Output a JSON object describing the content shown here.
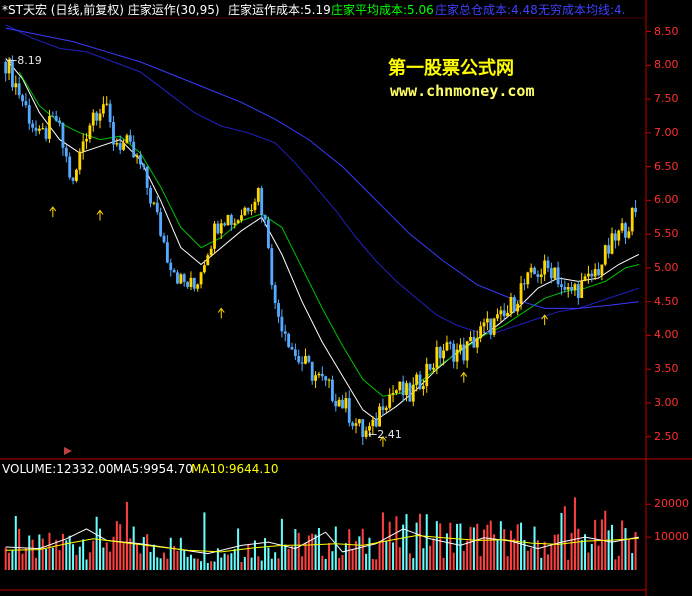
{
  "header": {
    "stock_name": "*ST天宏",
    "period_label": "(日线,前复权)",
    "indicator_name": "庄家运作",
    "indicator_params": "(30,95)",
    "cost_label": "庄家运作成本:5.19",
    "avg_cost_label": "庄家平均成本:5.06",
    "chip_cost_label": "庄家总仓成本:4.48",
    "infinite_cost_label": "无穷成本均线:4."
  },
  "watermark": {
    "title": "第一股票公式网",
    "url": "www.chnmoney.com"
  },
  "volume_header": {
    "volume_label": "VOLUME:12332.00",
    "ma5_label": "MA5:9954.70",
    "ma10_label": "MA10:9644.10"
  },
  "annotations": {
    "high_label": "8.19",
    "low_label": "2.41"
  },
  "colors": {
    "up": "#ffd700",
    "down": "#55aaff",
    "axis": "#c00000",
    "price_tick_text": "#ff3030",
    "header_white": "#ffffff",
    "header_green": "#00ff00",
    "header_blue": "#4040ff",
    "watermark_title": "#ffff00",
    "watermark_url": "#ffff66",
    "ma_white": "#ffffff",
    "ma_green": "#00c000",
    "ma_blue_dark": "#2020c0",
    "ma_blue": "#3a3aff",
    "vol_up": "#ff4040",
    "vol_down": "#66ffff",
    "vol_ma5": "#ffffff",
    "vol_ma10": "#ffff00"
  },
  "chart_data": [
    {
      "type": "candlestick",
      "price_axis": {
        "ylim": [
          2.2,
          8.7
        ],
        "ticks": [
          "8.50",
          "8.00",
          "7.50",
          "7.00",
          "6.50",
          "6.00",
          "5.50",
          "5.00",
          "4.50",
          "4.00",
          "3.50",
          "3.00",
          "2.50"
        ]
      },
      "anchors": [
        [
          0,
          8.05
        ],
        [
          4,
          7.6
        ],
        [
          10,
          6.9
        ],
        [
          15,
          7.2
        ],
        [
          20,
          6.2
        ],
        [
          23,
          6.9
        ],
        [
          26,
          7.3
        ],
        [
          29,
          7.45
        ],
        [
          32,
          6.9
        ],
        [
          36,
          6.8
        ],
        [
          40,
          6.5
        ],
        [
          44,
          5.9
        ],
        [
          48,
          5.2
        ],
        [
          52,
          4.8
        ],
        [
          56,
          4.7
        ],
        [
          60,
          5.3
        ],
        [
          64,
          5.8
        ],
        [
          68,
          5.7
        ],
        [
          72,
          5.95
        ],
        [
          75,
          6.15
        ],
        [
          78,
          5.4
        ],
        [
          80,
          4.4
        ],
        [
          83,
          4.1
        ],
        [
          86,
          3.7
        ],
        [
          90,
          3.5
        ],
        [
          95,
          3.25
        ],
        [
          100,
          3.0
        ],
        [
          106,
          2.55
        ],
        [
          109,
          2.6
        ],
        [
          112,
          3.05
        ],
        [
          116,
          3.2
        ],
        [
          120,
          3.1
        ],
        [
          125,
          3.5
        ],
        [
          130,
          3.8
        ],
        [
          136,
          3.75
        ],
        [
          142,
          4.1
        ],
        [
          148,
          4.25
        ],
        [
          153,
          4.7
        ],
        [
          158,
          4.95
        ],
        [
          163,
          5.0
        ],
        [
          166,
          4.6
        ],
        [
          169,
          4.7
        ],
        [
          172,
          4.75
        ],
        [
          176,
          5.0
        ],
        [
          180,
          5.35
        ],
        [
          183,
          5.55
        ],
        [
          186,
          5.75
        ]
      ],
      "ma_lines": [
        {
          "color": "#ffffff",
          "points": [
            [
              0,
              8.1
            ],
            [
              5,
              7.8
            ],
            [
              10,
              7.3
            ],
            [
              16,
              6.9
            ],
            [
              22,
              6.7
            ],
            [
              28,
              6.8
            ],
            [
              34,
              6.9
            ],
            [
              40,
              6.6
            ],
            [
              46,
              6.0
            ],
            [
              52,
              5.3
            ],
            [
              58,
              5.05
            ],
            [
              64,
              5.3
            ],
            [
              70,
              5.55
            ],
            [
              76,
              5.75
            ],
            [
              82,
              5.2
            ],
            [
              88,
              4.5
            ],
            [
              94,
              3.9
            ],
            [
              100,
              3.4
            ],
            [
              106,
              2.9
            ],
            [
              110,
              2.75
            ],
            [
              116,
              2.95
            ],
            [
              122,
              3.2
            ],
            [
              128,
              3.5
            ],
            [
              134,
              3.75
            ],
            [
              140,
              3.95
            ],
            [
              146,
              4.15
            ],
            [
              152,
              4.4
            ],
            [
              158,
              4.7
            ],
            [
              164,
              4.85
            ],
            [
              170,
              4.8
            ],
            [
              176,
              4.85
            ],
            [
              182,
              5.05
            ],
            [
              188,
              5.2
            ]
          ]
        },
        {
          "color": "#00c000",
          "points": [
            [
              4,
              7.9
            ],
            [
              10,
              7.4
            ],
            [
              16,
              7.15
            ],
            [
              22,
              7.0
            ],
            [
              28,
              6.9
            ],
            [
              34,
              6.95
            ],
            [
              40,
              6.7
            ],
            [
              46,
              6.2
            ],
            [
              52,
              5.6
            ],
            [
              58,
              5.3
            ],
            [
              64,
              5.45
            ],
            [
              70,
              5.7
            ],
            [
              76,
              5.8
            ],
            [
              82,
              5.6
            ],
            [
              88,
              5.0
            ],
            [
              94,
              4.4
            ],
            [
              100,
              3.85
            ],
            [
              106,
              3.35
            ],
            [
              112,
              3.1
            ],
            [
              118,
              3.15
            ],
            [
              124,
              3.35
            ],
            [
              130,
              3.6
            ],
            [
              136,
              3.8
            ],
            [
              142,
              4.0
            ],
            [
              148,
              4.15
            ],
            [
              154,
              4.35
            ],
            [
              160,
              4.55
            ],
            [
              166,
              4.65
            ],
            [
              172,
              4.7
            ],
            [
              178,
              4.8
            ],
            [
              184,
              5.0
            ],
            [
              188,
              5.05
            ]
          ]
        },
        {
          "color": "#2020c0",
          "points": [
            [
              0,
              8.6
            ],
            [
              8,
              8.4
            ],
            [
              16,
              8.25
            ],
            [
              24,
              8.2
            ],
            [
              32,
              8.05
            ],
            [
              40,
              7.9
            ],
            [
              48,
              7.6
            ],
            [
              56,
              7.3
            ],
            [
              64,
              7.1
            ],
            [
              72,
              7.0
            ],
            [
              80,
              6.85
            ],
            [
              86,
              6.55
            ],
            [
              92,
              6.2
            ],
            [
              98,
              5.85
            ],
            [
              104,
              5.45
            ],
            [
              110,
              5.1
            ],
            [
              116,
              4.8
            ],
            [
              122,
              4.55
            ],
            [
              128,
              4.3
            ],
            [
              134,
              4.15
            ],
            [
              140,
              4.05
            ],
            [
              146,
              4.05
            ],
            [
              152,
              4.15
            ],
            [
              158,
              4.25
            ],
            [
              164,
              4.35
            ],
            [
              170,
              4.4
            ],
            [
              176,
              4.5
            ],
            [
              182,
              4.6
            ],
            [
              188,
              4.7
            ]
          ]
        },
        {
          "color": "#3a3aff",
          "points": [
            [
              0,
              8.55
            ],
            [
              10,
              8.45
            ],
            [
              20,
              8.35
            ],
            [
              30,
              8.2
            ],
            [
              40,
              8.05
            ],
            [
              50,
              7.85
            ],
            [
              60,
              7.65
            ],
            [
              70,
              7.45
            ],
            [
              80,
              7.2
            ],
            [
              90,
              6.9
            ],
            [
              100,
              6.5
            ],
            [
              110,
              6.0
            ],
            [
              120,
              5.5
            ],
            [
              130,
              5.1
            ],
            [
              140,
              4.75
            ],
            [
              150,
              4.55
            ],
            [
              160,
              4.4
            ],
            [
              170,
              4.4
            ],
            [
              180,
              4.45
            ],
            [
              188,
              4.5
            ]
          ]
        }
      ],
      "arrows_up": [
        [
          14,
          5.9
        ],
        [
          28,
          5.85
        ],
        [
          64,
          4.4
        ],
        [
          112,
          2.5
        ],
        [
          136,
          3.45
        ],
        [
          160,
          4.3
        ]
      ]
    },
    {
      "type": "bar",
      "series": "volume",
      "ylim": [
        0,
        28000
      ],
      "ticks": [
        "20000",
        "10000"
      ],
      "ma5": [
        [
          0,
          7000
        ],
        [
          10,
          6500
        ],
        [
          18,
          9500
        ],
        [
          24,
          12500
        ],
        [
          30,
          9000
        ],
        [
          40,
          8000
        ],
        [
          50,
          6500
        ],
        [
          60,
          5000
        ],
        [
          70,
          7500
        ],
        [
          78,
          8500
        ],
        [
          86,
          6500
        ],
        [
          95,
          11500
        ],
        [
          100,
          5500
        ],
        [
          110,
          8000
        ],
        [
          118,
          12500
        ],
        [
          126,
          9500
        ],
        [
          135,
          7500
        ],
        [
          142,
          9800
        ],
        [
          150,
          8800
        ],
        [
          158,
          6500
        ],
        [
          165,
          8500
        ],
        [
          172,
          10000
        ],
        [
          180,
          8500
        ],
        [
          188,
          10000
        ]
      ],
      "ma10": [
        [
          0,
          6000
        ],
        [
          10,
          6200
        ],
        [
          18,
          8000
        ],
        [
          26,
          9500
        ],
        [
          34,
          8500
        ],
        [
          44,
          7200
        ],
        [
          54,
          6000
        ],
        [
          64,
          5500
        ],
        [
          74,
          6800
        ],
        [
          82,
          7500
        ],
        [
          90,
          7600
        ],
        [
          98,
          8000
        ],
        [
          106,
          7500
        ],
        [
          114,
          9000
        ],
        [
          122,
          10500
        ],
        [
          130,
          9800
        ],
        [
          140,
          9000
        ],
        [
          148,
          9200
        ],
        [
          156,
          8200
        ],
        [
          164,
          7800
        ],
        [
          172,
          8800
        ],
        [
          180,
          9100
        ],
        [
          188,
          9644
        ]
      ]
    }
  ]
}
